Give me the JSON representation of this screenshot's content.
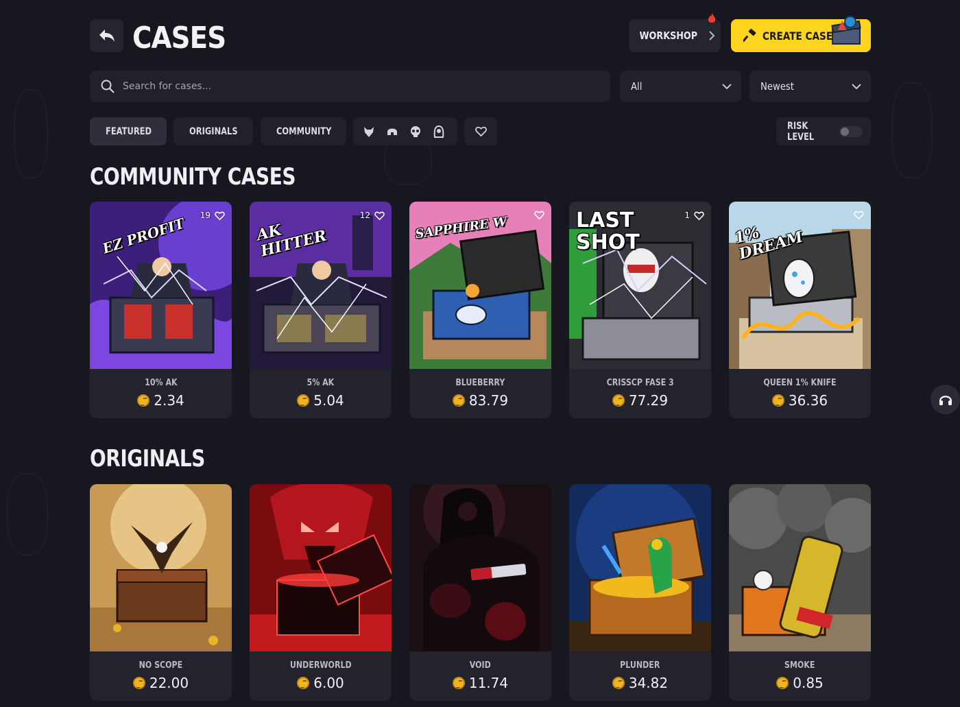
{
  "header": {
    "title": "CASES",
    "workshop_label": "WORKSHOP",
    "create_label": "CREATE CASE"
  },
  "search": {
    "placeholder": "Search for cases..."
  },
  "filters": {
    "category_selected": "All",
    "sort_selected": "Newest"
  },
  "tabs": [
    {
      "label": "FEATURED",
      "icon": "flame-icon",
      "active": true
    },
    {
      "label": "ORIGINALS",
      "icon": "originals-logo-icon",
      "active": false
    },
    {
      "label": "COMMUNITY",
      "icon": "users-icon",
      "active": false
    }
  ],
  "icon_tabs": [
    "wolf-icon",
    "helmet-icon",
    "skull-icon",
    "reaper-icon"
  ],
  "favorites_tab_icon": "heart-icon",
  "risk": {
    "label": "RISK LEVEL",
    "enabled": false
  },
  "community": {
    "title": "COMMUNITY CASES",
    "cards": [
      {
        "name": "10% AK",
        "price": "2.34",
        "favorites": "19",
        "art_caption": "EZ PROFIT"
      },
      {
        "name": "5% AK",
        "price": "5.04",
        "favorites": "12",
        "art_caption": "AK HITTER"
      },
      {
        "name": "BLUEBERRY",
        "price": "83.79",
        "favorites": "",
        "art_caption": "SAPPHIRE W"
      },
      {
        "name": "CRISSCP FASE 3",
        "price": "77.29",
        "favorites": "1",
        "art_caption": "LAST SHOT"
      },
      {
        "name": "QUEEN 1% KNIFE",
        "price": "36.36",
        "favorites": "",
        "art_caption": "1% DREAM"
      }
    ]
  },
  "originals": {
    "title": "ORIGINALS",
    "cards": [
      {
        "name": "NO SCOPE",
        "price": "22.00"
      },
      {
        "name": "UNDERWORLD",
        "price": "6.00"
      },
      {
        "name": "VOID",
        "price": "11.74"
      },
      {
        "name": "PLUNDER",
        "price": "34.82"
      },
      {
        "name": "SMOKE",
        "price": "0.85"
      }
    ]
  },
  "colors": {
    "accent": "#ffd41f",
    "background": "#17181f",
    "card": "#22232c",
    "coin": "#f0b422"
  }
}
